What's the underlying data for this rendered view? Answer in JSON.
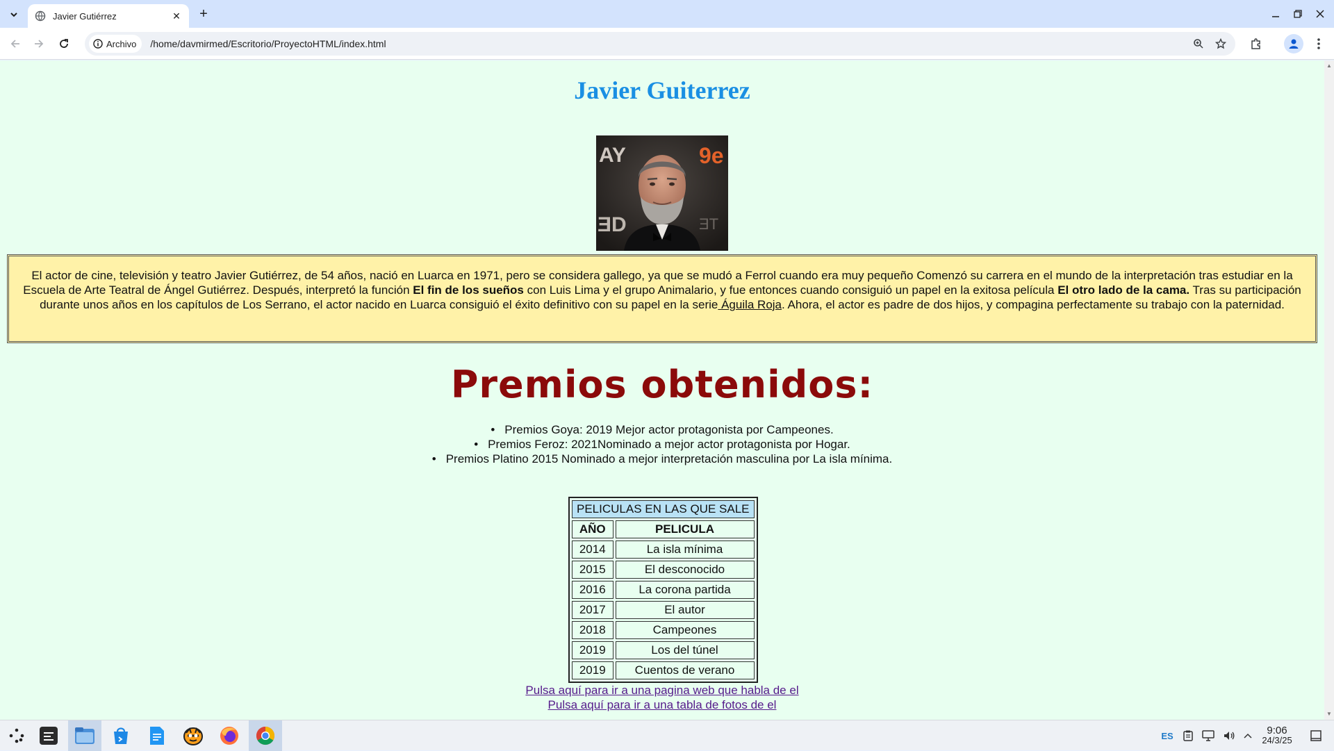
{
  "browser": {
    "tab_title": "Javier Gutiérrez",
    "address_chip": "Archivo",
    "url": "/home/davmirmed/Escritorio/ProyectoHTML/index.html"
  },
  "page": {
    "title": "Javier Guiterrez",
    "photo_alt": "Javier Gutiérrez",
    "bio": {
      "p1": "El actor de cine, televisión y teatro Javier Gutiérrez, de 54 años, nació en Luarca en 1971, pero se considera gallego, ya que se mudó a Ferrol cuando era muy pequeño Comenzó su carrera en el mundo de la interpretación tras estudiar en la Escuela de Arte Teatral de Ángel Gutiérrez. Después, interpretó la función ",
      "bold1": "El fin de los sueños",
      "p2": " con Luis Lima y el grupo Animalario, y fue entonces cuando consiguió un papel en la exitosa película ",
      "bold2": "El otro lado de la cama.",
      "p3": " Tras su participación durante unos años en los capítulos de Los Serrano, el actor nacido en Luarca consiguió el éxito definitivo con su papel en la serie",
      "link": " Águila Roja",
      "p4": ". Ahora, el actor es padre de dos hijos, y compagina perfectamente su trabajo con la paternidad."
    },
    "awards_title": "Premios obtenidos:",
    "awards": [
      "Premios Goya: 2019 Mejor actor protagonista por Campeones.",
      "Premios Feroz: 2021Nominado a mejor actor protagonista por Hogar.",
      "Premios Platino 2015 Nominado a mejor interpretación masculina por La isla mínima."
    ],
    "films_table": {
      "caption": "PELICULAS EN LAS QUE SALE",
      "headers": [
        "AÑO",
        "PELICULA"
      ],
      "rows": [
        [
          "2014",
          "La isla mínima"
        ],
        [
          "2015",
          "El desconocido"
        ],
        [
          "2016",
          "La corona partida"
        ],
        [
          "2017",
          "El autor"
        ],
        [
          "2018",
          "Campeones"
        ],
        [
          "2019",
          "Los del túnel"
        ],
        [
          "2019",
          "Cuentos de verano"
        ]
      ]
    },
    "links": [
      "Pulsa aquí para ir a una pagina web que habla de el",
      "Pulsa aquí para ir a una tabla de fotos de el"
    ]
  },
  "taskbar": {
    "lang": "ES",
    "time": "9:06",
    "date": "24/3/25",
    "apps": [
      "launcher-icon",
      "terminal-icon",
      "files-icon",
      "store-icon",
      "text-editor-icon",
      "cat-app-icon",
      "firefox-icon",
      "chrome-icon"
    ]
  },
  "colors": {
    "page_bg": "#e8fff0",
    "title": "#1a8fe3",
    "bio_bg": "#fff2a8",
    "awards_title": "#8b0a0a",
    "table_header_bg": "#b9e2f5",
    "link": "#551a8b"
  }
}
